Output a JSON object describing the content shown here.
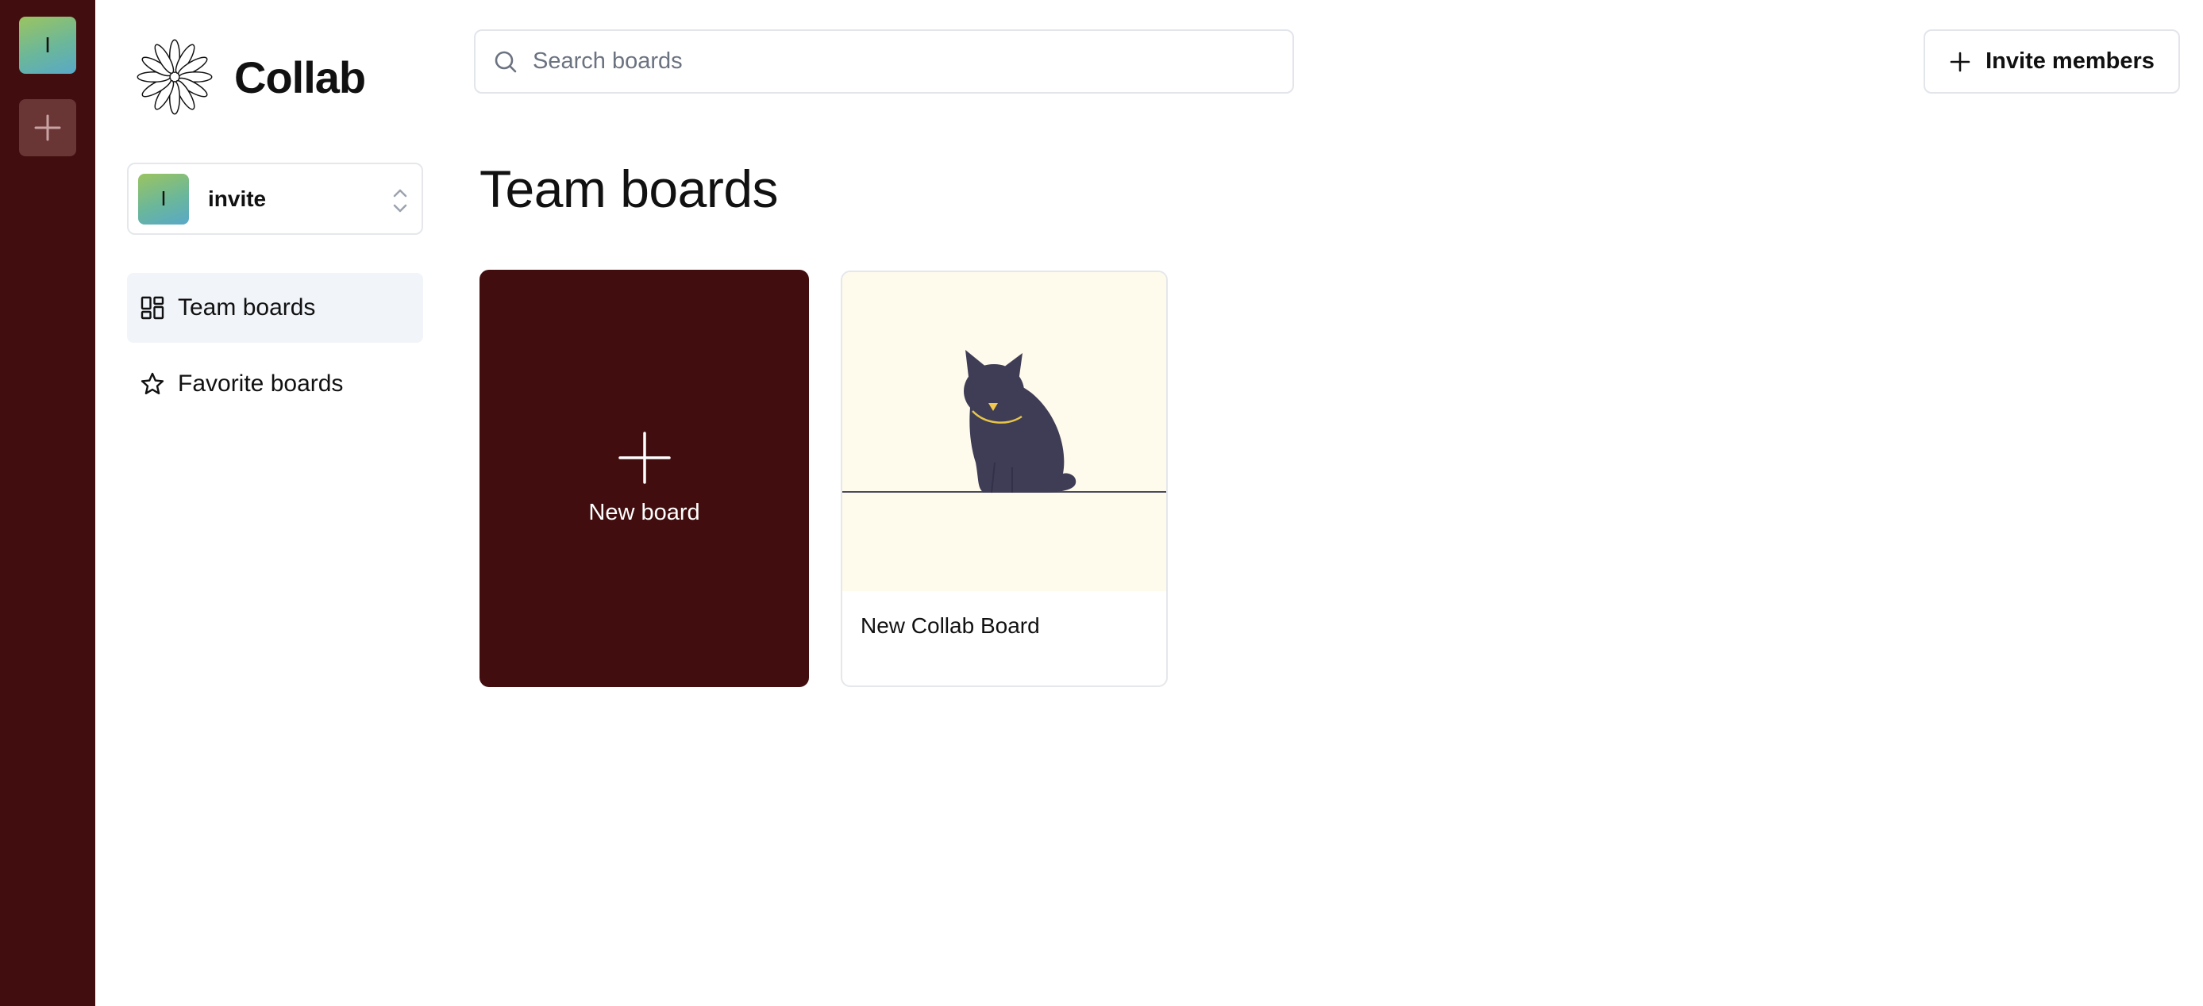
{
  "org_rail": {
    "active_org_initial": "I"
  },
  "brand": {
    "name": "Collab"
  },
  "org_switcher": {
    "initial": "I",
    "name": "invite"
  },
  "sidebar": {
    "items": [
      {
        "label": "Team boards",
        "icon": "dashboard-icon",
        "active": true
      },
      {
        "label": "Favorite boards",
        "icon": "star-icon",
        "active": false
      }
    ]
  },
  "header": {
    "search_placeholder": "Search boards",
    "invite_label": "Invite members"
  },
  "main": {
    "title": "Team boards",
    "new_board_label": "New board",
    "boards": [
      {
        "title": "New Collab Board",
        "thumbnail": "cat-illustration"
      }
    ]
  },
  "colors": {
    "rail": "#420d0e",
    "accent": "#420d0e",
    "active_nav": "#f1f4f9",
    "thumb_bg": "#fefaec"
  }
}
